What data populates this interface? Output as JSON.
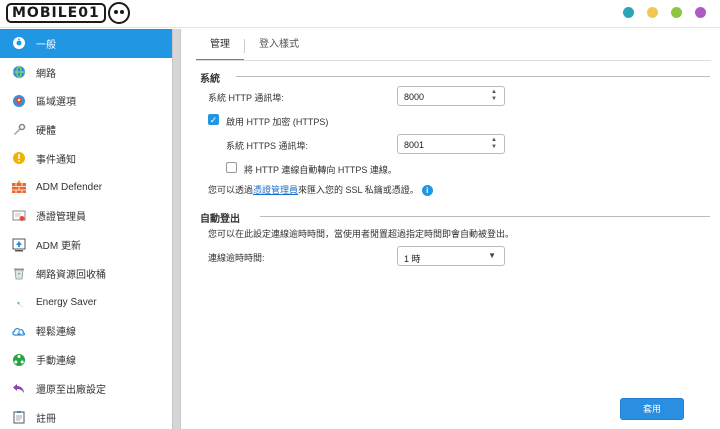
{
  "app": {
    "logo_text": "MOBILE01",
    "window_dots": [
      "#2aa6b8",
      "#f2c94c",
      "#8cc63f",
      "#b05bc4"
    ]
  },
  "sidebar": {
    "items": [
      {
        "label": "一般",
        "icon": "general-gear-icon",
        "active": true
      },
      {
        "label": "網路",
        "icon": "globe-icon",
        "active": false
      },
      {
        "label": "區域選項",
        "icon": "location-pin-icon",
        "active": false
      },
      {
        "label": "硬體",
        "icon": "hardware-wrench-icon",
        "active": false
      },
      {
        "label": "事件通知",
        "icon": "warning-icon",
        "active": false
      },
      {
        "label": "ADM Defender",
        "icon": "firewall-icon",
        "active": false
      },
      {
        "label": "憑證管理員",
        "icon": "certificate-icon",
        "active": false
      },
      {
        "label": "ADM 更新",
        "icon": "update-icon",
        "active": false
      },
      {
        "label": "網路資源回收桶",
        "icon": "recycle-bin-icon",
        "active": false
      },
      {
        "label": "Energy Saver",
        "icon": "energy-bolt-icon",
        "active": false
      },
      {
        "label": "輕鬆連線",
        "icon": "cloud-connect-icon",
        "active": false
      },
      {
        "label": "手動連線",
        "icon": "manual-connect-icon",
        "active": false
      },
      {
        "label": "還原至出廠設定",
        "icon": "restore-arrow-icon",
        "active": false
      },
      {
        "label": "註冊",
        "icon": "register-clipboard-icon",
        "active": false
      }
    ]
  },
  "tabs": [
    {
      "label": "管理",
      "active": true
    },
    {
      "label": "登入樣式",
      "active": false
    }
  ],
  "system": {
    "title": "系統",
    "http_port_label": "系統 HTTP 通訊埠:",
    "http_port_value": "8000",
    "https_enable_label": "啟用 HTTP 加密 (HTTPS)",
    "https_enabled": true,
    "https_port_label": "系統 HTTPS 通訊埠:",
    "https_port_value": "8001",
    "redirect_label": "將 HTTP 連線自動轉向 HTTPS 連線。",
    "redirect_enabled": false,
    "ssl_text_prefix": "您可以透過",
    "ssl_link": "憑證管理員",
    "ssl_text_suffix": "來匯入您的 SSL 私鑰或憑證。"
  },
  "autologout": {
    "title": "自動登出",
    "description": "您可以在此設定連線逾時時間，當使用者閒置超過指定時間即會自動被登出。",
    "timeout_label": "連線逾時時間:",
    "timeout_value": "1 時"
  },
  "footer": {
    "apply_label": "套用"
  }
}
